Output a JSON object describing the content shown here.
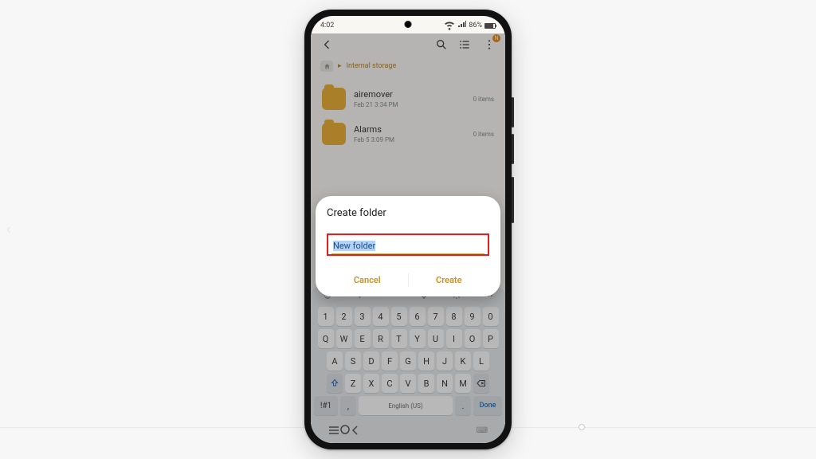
{
  "status": {
    "time": "4:02",
    "battery_pct": "86%"
  },
  "breadcrumb": {
    "current": "Internal storage"
  },
  "folders": [
    {
      "name": "airemover",
      "sub": "Feb 21 3:34 PM",
      "count": "0 items"
    },
    {
      "name": "Alarms",
      "sub": "Feb 5 3:09 PM",
      "count": "0 items"
    }
  ],
  "dialog": {
    "title": "Create folder",
    "input_value": "New folder",
    "cancel": "Cancel",
    "create": "Create"
  },
  "keyboard": {
    "nums": [
      "1",
      "2",
      "3",
      "4",
      "5",
      "6",
      "7",
      "8",
      "9",
      "0"
    ],
    "row1": [
      "Q",
      "W",
      "E",
      "R",
      "T",
      "Y",
      "U",
      "I",
      "O",
      "P"
    ],
    "row2": [
      "A",
      "S",
      "D",
      "F",
      "G",
      "H",
      "J",
      "K",
      "L"
    ],
    "row3": [
      "Z",
      "X",
      "C",
      "V",
      "B",
      "N",
      "M"
    ],
    "sym": "!#1",
    "space": "English (US)",
    "done": "Done"
  }
}
